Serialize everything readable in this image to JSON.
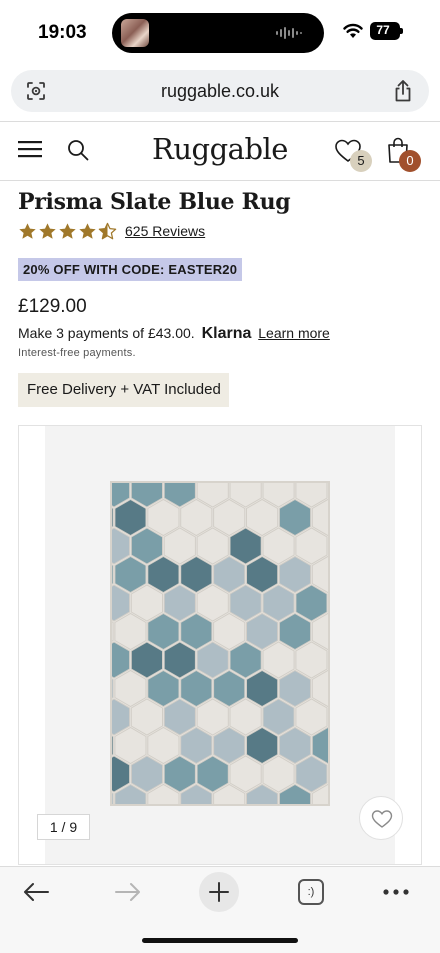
{
  "status_bar": {
    "time": "19:03",
    "battery": "77",
    "icons": [
      "now-playing-thumb",
      "audio-wave-icon",
      "wifi-icon",
      "battery-icon"
    ]
  },
  "browser": {
    "url": "ruggable.co.uk",
    "tab_label": ":)",
    "toolbar_icons": [
      "back-arrow-icon",
      "forward-arrow-icon",
      "plus-icon",
      "tabs-icon",
      "more-dots-icon"
    ]
  },
  "site_header": {
    "logo": "Ruggable",
    "wishlist_count": "5",
    "bag_count": "0",
    "icons": [
      "menu-icon",
      "search-icon",
      "heart-icon",
      "bag-icon"
    ]
  },
  "product": {
    "title": "Prisma Slate Blue Rug",
    "rating_stars": 4.5,
    "reviews": "625 Reviews",
    "promo": "20% OFF WITH CODE: EASTER20",
    "price": "£129.00",
    "klarna_text": "Make 3 payments of £43.00.",
    "klarna_logo": "Klarna",
    "klarna_link": "Learn more",
    "interest_note": "Interest-free payments.",
    "delivery": "Free Delivery + VAT Included"
  },
  "gallery": {
    "counter": "1 / 9",
    "colors": {
      "rug_base": "#e7e4df",
      "hex_dark": "#577a86",
      "hex_mid": "#7a9ea8",
      "hex_light": "#aebdc5"
    }
  },
  "colors": {
    "promo_bg": "#c5c8e8",
    "delivery_bg": "#efece3",
    "star": "#a0782a",
    "bag_badge": "#a1502d",
    "wishlist_badge": "#d8d0bd"
  }
}
